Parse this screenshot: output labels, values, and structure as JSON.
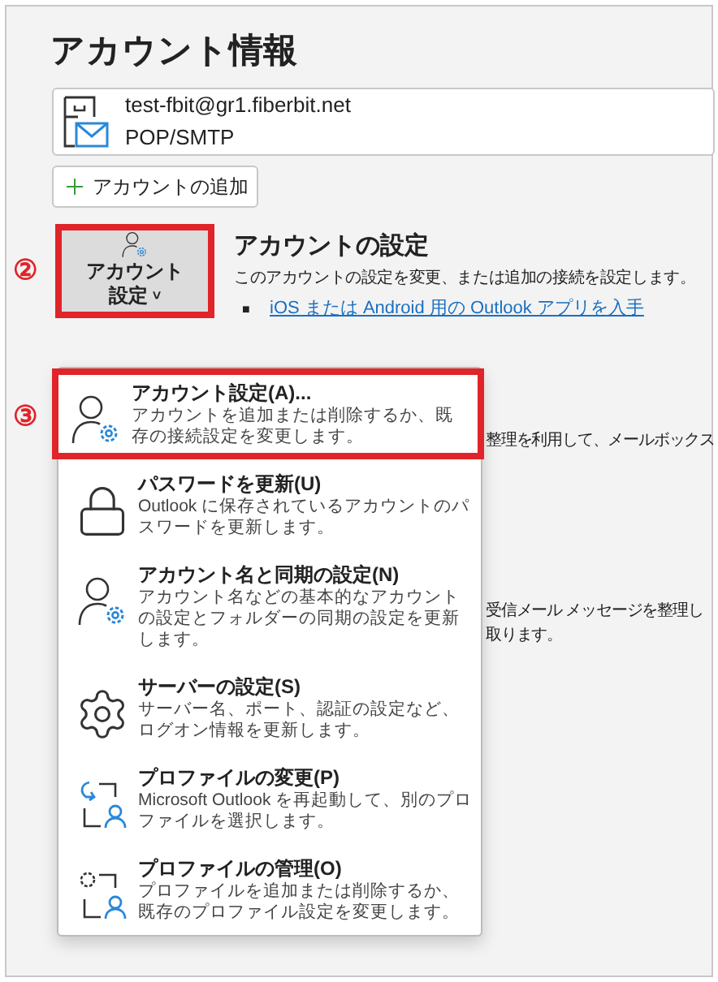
{
  "title": "アカウント情報",
  "account": {
    "email": "test-fbit@gr1.fiberbit.net",
    "type": "POP/SMTP"
  },
  "add_account_button": "アカウントの追加",
  "settings_button": {
    "label_line1": "アカウント",
    "label_line2": "設定",
    "caret": "˅",
    "highlighted": true,
    "step": "②"
  },
  "settings_section": {
    "heading": "アカウントの設定",
    "description": "このアカウントの設定を変更、または追加の接続を設定します。",
    "bullet": "■",
    "link": "iOS または Android 用の Outlook アプリを入手"
  },
  "background_texts": [
    "整理を利用して、メールボックス",
    "受信メール メッセージを整理し",
    "取ります。"
  ],
  "menu": {
    "step": "③",
    "items": [
      {
        "kind": "account",
        "title": "アカウント設定(A)...",
        "description": "アカウントを追加または削除するか、既存の接続設定を変更します。",
        "highlighted": true
      },
      {
        "kind": "lock",
        "title": "パスワードを更新(U)",
        "description": "Outlook に保存されているアカウントのパスワードを更新します。",
        "highlighted": false
      },
      {
        "kind": "account",
        "title": "アカウント名と同期の設定(N)",
        "description": "アカウント名などの基本的なアカウントの設定とフォルダーの同期の設定を更新します。",
        "highlighted": false
      },
      {
        "kind": "gear",
        "title": "サーバーの設定(S)",
        "description": "サーバー名、ポート、認証の設定など、ログオン情報を更新します。",
        "highlighted": false
      },
      {
        "kind": "profile-change",
        "title": "プロファイルの変更(P)",
        "description": "Microsoft Outlook を再起動して、別のプロファイルを選択します。",
        "highlighted": false
      },
      {
        "kind": "profile-manage",
        "title": "プロファイルの管理(O)",
        "description": "プロファイルを追加または削除するか、既存のプロファイル設定を変更します。",
        "highlighted": false
      }
    ]
  }
}
